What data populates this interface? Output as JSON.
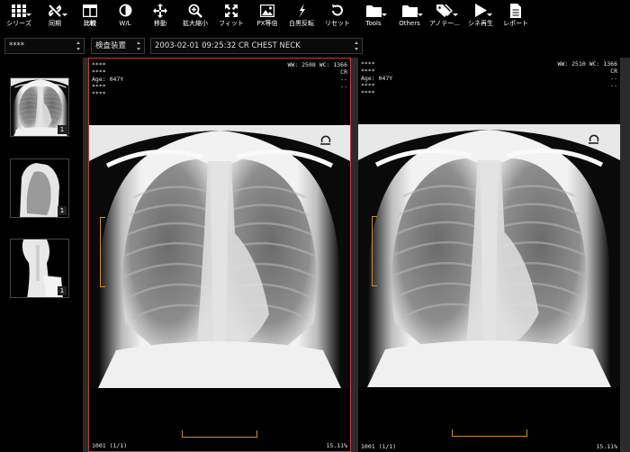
{
  "toolbar": {
    "series": "シリーズ",
    "sync": "同期",
    "compare": "比較",
    "wl": "W/L",
    "move": "移動",
    "zoom": "拡大縮小",
    "fit": "フィット",
    "px_equal": "PX等倍",
    "invert": "白黒反転",
    "reset": "リセット",
    "tools": "Tools",
    "others": "Others",
    "annotation": "アノテー...",
    "cine": "シネ再生",
    "report": "レポート"
  },
  "selectors": {
    "patient": "****",
    "exam_device": "検査装置",
    "study": "2003-02-01 09:25:32 CR CHEST NECK"
  },
  "thumbnails": [
    {
      "count": "1",
      "selected": true,
      "check": "✓"
    },
    {
      "count": "1",
      "selected": false
    },
    {
      "count": "1",
      "selected": false
    }
  ],
  "viewports": [
    {
      "tl_lines": "****\n****\nAge: 047Y\n****\n****",
      "tr_lines": "WW: 2508 WC: 1366\nCR\n--\n--",
      "bl": "1001 (1/1)",
      "br": "15.11%"
    },
    {
      "tl_lines": "****\n****\nAge: 047Y\n****\n****",
      "tr_lines": "WW: 2510 WC: 1366\nCR\n--\n--",
      "bl": "1001 (1/1)",
      "br": "15.11%"
    }
  ],
  "colors": {
    "accent_active_border": "#c43c3c",
    "ruler": "#d08a2a",
    "background": "#000000",
    "gutter": "#2b2b2b"
  }
}
